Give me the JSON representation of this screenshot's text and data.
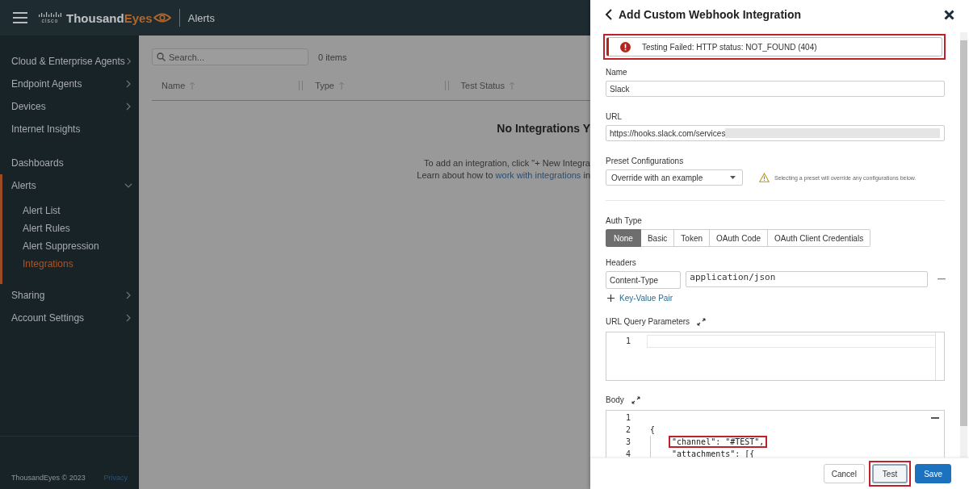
{
  "header": {
    "brand": {
      "cisco": "cisco",
      "name": "Thousand",
      "accent": "Eyes"
    },
    "page_title": "Alerts"
  },
  "sidebar": {
    "sections": [
      [
        {
          "label": "Cloud & Enterprise Agents",
          "expandable": true,
          "expanded": false
        },
        {
          "label": "Endpoint Agents",
          "expandable": true,
          "expanded": false
        },
        {
          "label": "Devices",
          "expandable": true,
          "expanded": false
        },
        {
          "label": "Internet Insights",
          "expandable": false
        }
      ],
      [
        {
          "label": "Dashboards",
          "expandable": false
        },
        {
          "label": "Alerts",
          "expandable": true,
          "expanded": true,
          "children": [
            {
              "label": "Alert List",
              "selected": false
            },
            {
              "label": "Alert Rules",
              "selected": false
            },
            {
              "label": "Alert Suppression",
              "selected": false
            },
            {
              "label": "Integrations",
              "selected": true
            }
          ]
        },
        {
          "label": "Sharing",
          "expandable": true,
          "expanded": false
        },
        {
          "label": "Account Settings",
          "expandable": true,
          "expanded": false
        }
      ]
    ],
    "copyright": "ThousandEyes © 2023",
    "privacy_link": "Privacy"
  },
  "main": {
    "search": {
      "placeholder": "Search..."
    },
    "count": "0 items",
    "columns": [
      "Name",
      "Type",
      "Test Status"
    ],
    "empty": {
      "title": "No Integrations Y",
      "line_1": "To add an integration, click \"+ New Integra",
      "line_2_prefix": "Learn about how to ",
      "line_2_link": "work with integrations",
      "line_2_suffix": " in"
    }
  },
  "panel": {
    "title": "Add Custom Webhook Integration",
    "alert": {
      "text": "Testing Failed: HTTP status: NOT_FOUND (404)",
      "highlighted": true
    },
    "name": {
      "label": "Name",
      "value": "Slack"
    },
    "url": {
      "label": "URL",
      "value": "https://hooks.slack.com/services",
      "redacted": true
    },
    "preset": {
      "label": "Preset Configurations",
      "value": "Override with an example",
      "warning": "Selecting a preset will override any configurations below."
    },
    "auth": {
      "label": "Auth Type",
      "options": [
        {
          "label": "None",
          "selected": true
        },
        {
          "label": "Basic",
          "selected": false
        },
        {
          "label": "Token",
          "selected": false
        },
        {
          "label": "OAuth Code",
          "selected": false
        },
        {
          "label": "OAuth Client Credentials",
          "selected": false
        }
      ]
    },
    "headers": {
      "label": "Headers",
      "rows": [
        {
          "key": "Content-Type",
          "value": "application/json"
        }
      ],
      "add_link": "Key-Value Pair"
    },
    "query": {
      "label": "URL Query Parameters",
      "lines": [
        {
          "number": "1",
          "active": true
        }
      ]
    },
    "body": {
      "label": "Body",
      "lines": [
        {
          "number": "1",
          "active": false
        },
        {
          "number": "2",
          "text": "{",
          "active": false,
          "children": [
            {
              "number": "3",
              "text": "\"channel\": \"#TEST\",",
              "active": false,
              "highlighted": true
            },
            {
              "number": "4",
              "text": "\"attachments\": [{",
              "active": false,
              "highlighted": false
            }
          ]
        }
      ]
    },
    "buttons": [
      {
        "label": "Cancel",
        "kind": "default",
        "highlighted": false
      },
      {
        "label": "Test",
        "kind": "default",
        "highlighted": true
      },
      {
        "label": "Save",
        "kind": "primary",
        "highlighted": false
      }
    ]
  }
}
